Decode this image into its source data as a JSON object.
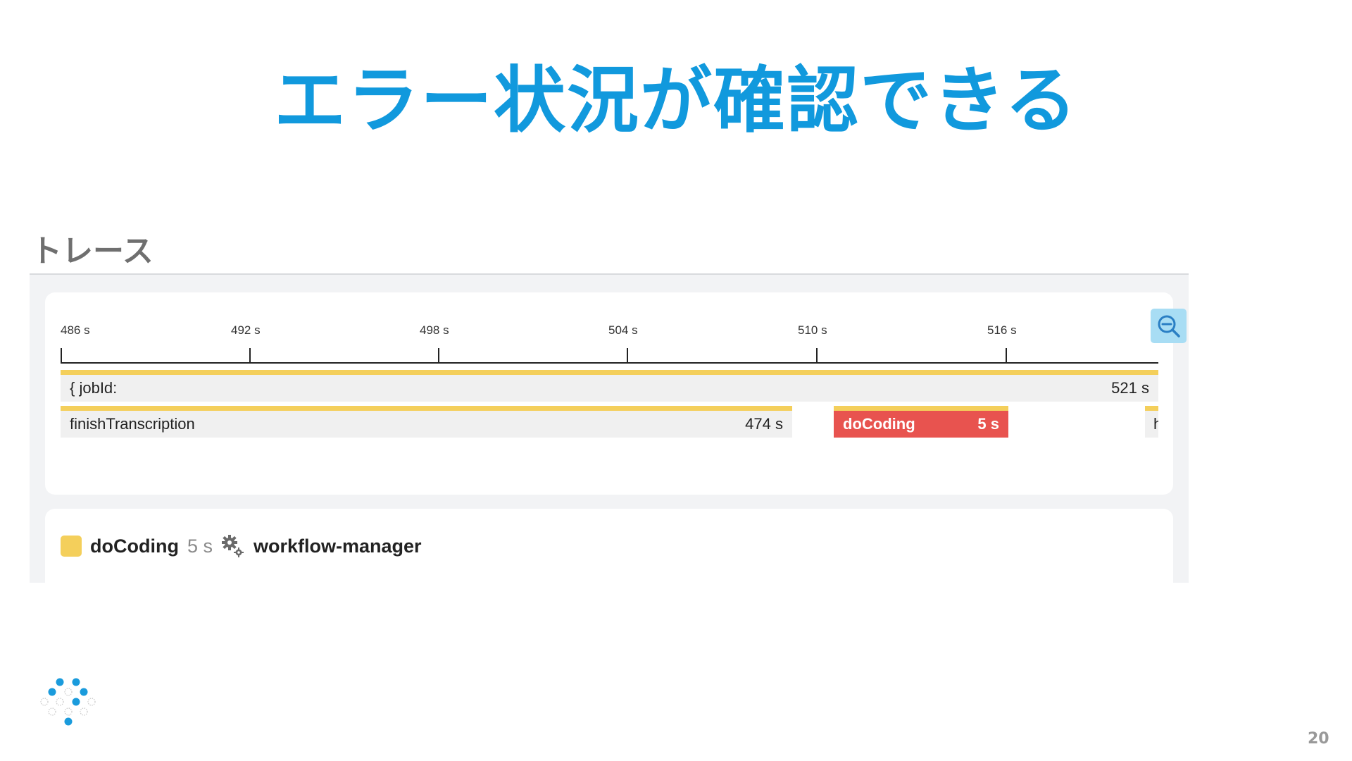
{
  "slide": {
    "title": "エラー状況が確認できる",
    "section_heading": "トレース",
    "page_number": "20"
  },
  "timeline": {
    "ticks": [
      "486 s",
      "492 s",
      "498 s",
      "504 s",
      "510 s",
      "516 s"
    ],
    "zoom_icon": "zoom-out-icon",
    "spans": [
      {
        "name": "{ jobId:",
        "duration": "521 s",
        "status": "ok"
      },
      {
        "name": "finishTranscription",
        "duration": "474 s",
        "status": "ok"
      },
      {
        "name": "doCoding",
        "duration": "5 s",
        "status": "error"
      },
      {
        "name": "h",
        "duration": "",
        "status": "ok"
      }
    ]
  },
  "detail": {
    "operation": "doCoding",
    "duration": "5 s",
    "service_icon": "gears-icon",
    "service": "workflow-manager"
  },
  "colors": {
    "title": "#1199dd",
    "span_bar": "#f4cf5b",
    "error_span": "#e8534f",
    "zoom_button": "#a8ddf4"
  }
}
